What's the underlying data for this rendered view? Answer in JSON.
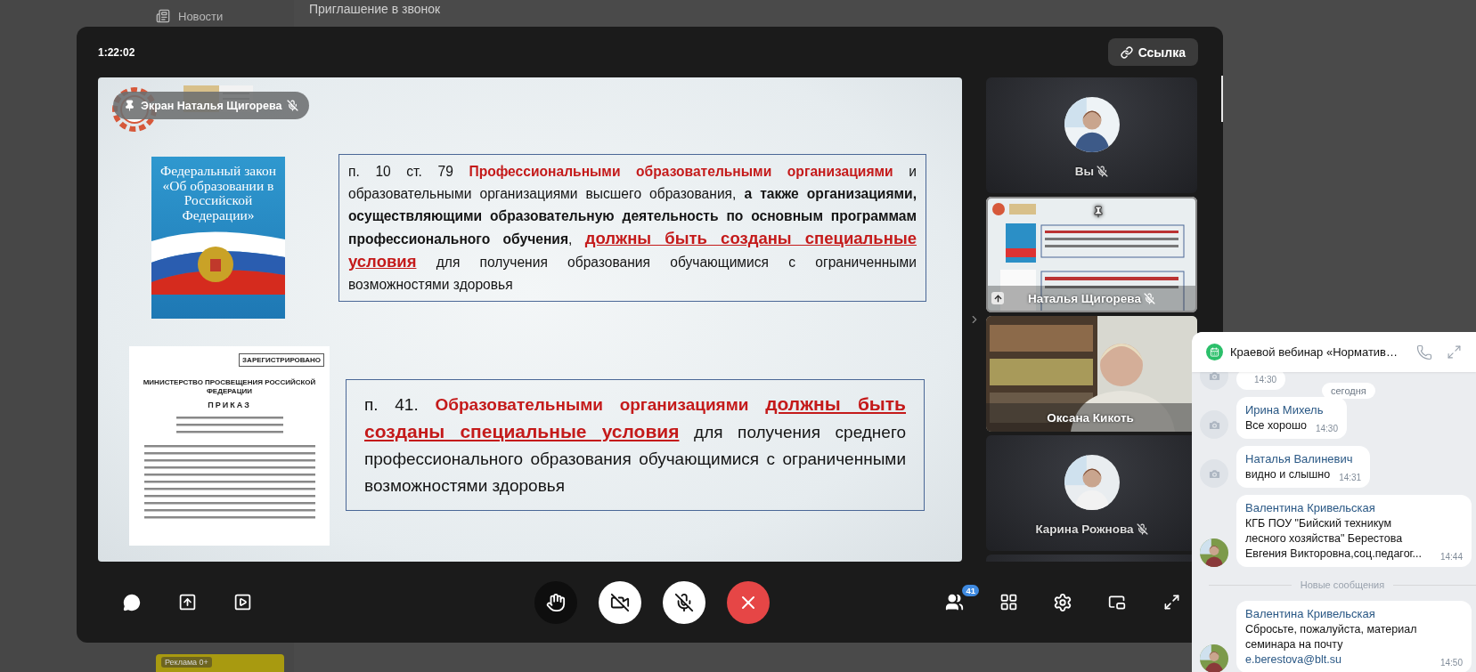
{
  "background_page": {
    "nav_item": "Новости",
    "title": "Приглашение в звонок",
    "ad_label": "Реклама 0+"
  },
  "call": {
    "timer": "1:22:02",
    "link_button": "Ссылка",
    "screen_share": {
      "overlay_label": "Экран Наталья Щигорева",
      "muted": true,
      "slide": {
        "book_title": "Федеральный закон «Об образовании в Российской Федерации»",
        "document_heading": "МИНИСТЕРСТВО ПРОСВЕЩЕНИЯ РОССИЙСКОЙ ФЕДЕРАЦИИ",
        "document_stamp": "ЗАРЕГИСТРИРОВАНО",
        "document_title": "ПРИКАЗ",
        "text_blocks": [
          {
            "segments": [
              {
                "kind": "plain",
                "text": "п. 10 ст. 79  "
              },
              {
                "kind": "accent",
                "text": "Профессиональными образовательными организациями"
              },
              {
                "kind": "plain",
                "text": " и образовательными организациями высшего образования, "
              },
              {
                "kind": "bold",
                "text": "а также организациями, осуществляющими образовательную деятельность по основным программам профессионального обучения"
              },
              {
                "kind": "plain",
                "text": ", "
              },
              {
                "kind": "accent-underline",
                "text": "должны быть созданы специальные условия"
              },
              {
                "kind": "plain",
                "text": " для получения образования обучающимися с ограниченными возможностями здоровья"
              }
            ]
          },
          {
            "segments": [
              {
                "kind": "plain",
                "text": "п. 41. "
              },
              {
                "kind": "accent",
                "text": "Образовательными организациями "
              },
              {
                "kind": "accent-underline",
                "text": "должны быть созданы специальные условия"
              },
              {
                "kind": "plain",
                "text": " для получения среднего профессионального образования обучающимися с ограниченными возможностями здоровья"
              }
            ]
          }
        ]
      }
    },
    "participants": [
      {
        "kind": "avatar",
        "name": "Вы",
        "muted": true,
        "pinned": false
      },
      {
        "kind": "screen",
        "name": "Наталья Щигорева",
        "muted": true,
        "pinned": true
      },
      {
        "kind": "video",
        "name": "Оксана Кикоть",
        "muted": false,
        "pinned": false
      },
      {
        "kind": "avatar",
        "name": "Карина Рожнова",
        "muted": true,
        "pinned": false
      }
    ],
    "toolbar": {
      "camera_on": false,
      "mic_on": false,
      "participants_count": "41"
    }
  },
  "chat": {
    "title": "Краевой вебинар «Норматив…",
    "date_chip": "сегодня",
    "new_divider": "Новые сообщения",
    "messages": [
      {
        "kind": "placeholder",
        "time": "14:30"
      },
      {
        "kind": "placeholder",
        "author": "Ирина Михель",
        "text": "Все хорошо",
        "time": "14:30"
      },
      {
        "kind": "placeholder",
        "author": "Наталья Валиневич",
        "text": "видно и слышно",
        "time": "14:31"
      },
      {
        "author": "Валентина Кривельская",
        "text": "КГБ ПОУ \"Бийский техникум лесного хозяйства\" Берестова Евгения Викторовна,соц.педагог...",
        "time": "14:44"
      }
    ],
    "new_messages": [
      {
        "author": "Валентина Кривельская",
        "text": "Сбросьте, пожалуйста, материал семинара на почту",
        "link": "e.berestova@blt.su",
        "time": "14:50"
      }
    ]
  }
}
